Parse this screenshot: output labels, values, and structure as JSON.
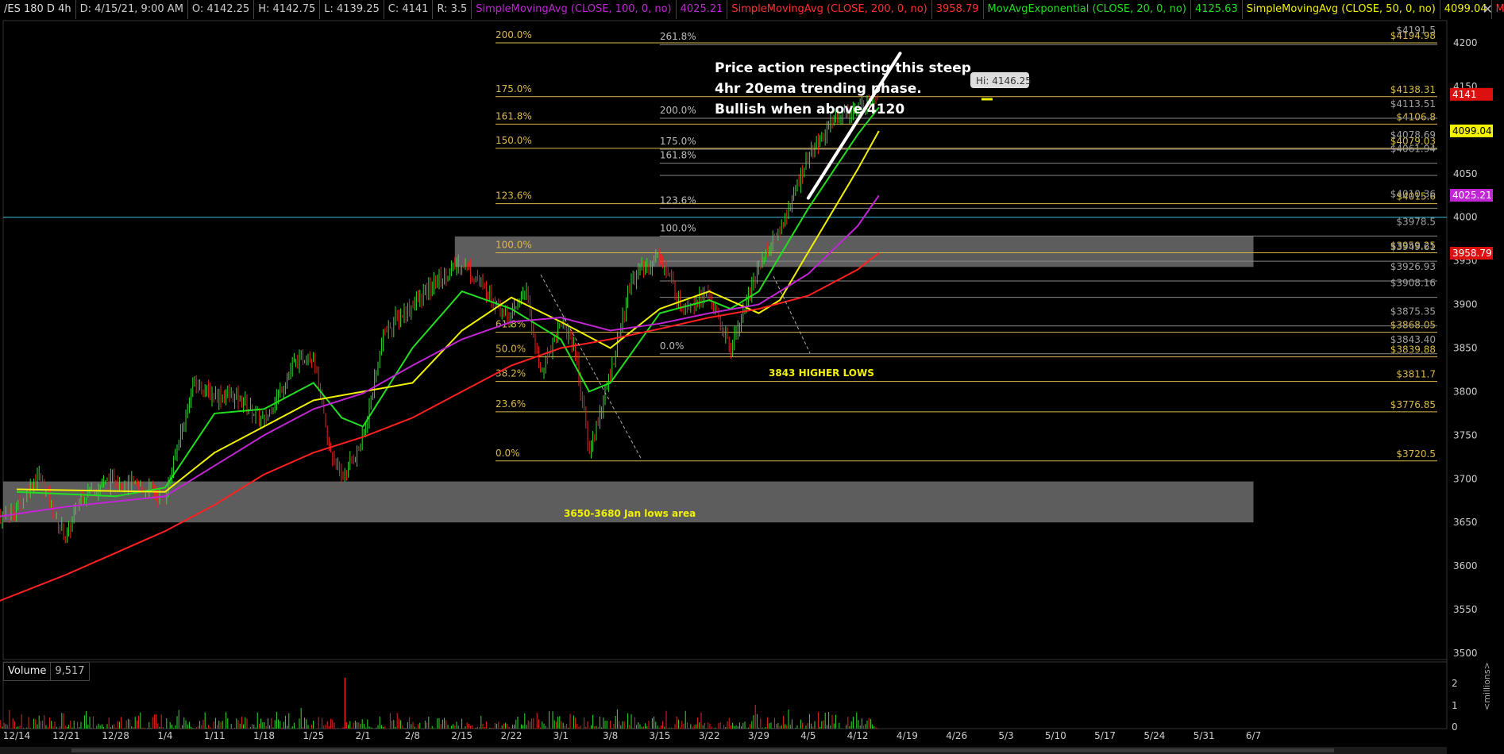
{
  "header": {
    "segments": [
      {
        "text": "/ES 180 D 4h",
        "color": "#dddddd"
      },
      {
        "text": "D: 4/15/21, 9:00 AM",
        "color": "#cccccc"
      },
      {
        "text": "O: 4142.25",
        "color": "#cccccc"
      },
      {
        "text": "H: 4142.75",
        "color": "#cccccc"
      },
      {
        "text": "L: 4139.25",
        "color": "#cccccc"
      },
      {
        "text": "C: 4141",
        "color": "#cccccc"
      },
      {
        "text": "R: 3.5",
        "color": "#cccccc"
      },
      {
        "text": "SimpleMovingAvg (CLOSE, 100, 0, no)",
        "color": "#c026d3"
      },
      {
        "text": "4025.21",
        "color": "#c026d3"
      },
      {
        "text": "SimpleMovingAvg (CLOSE, 200, 0, no)",
        "color": "#ff3030"
      },
      {
        "text": "3958.79",
        "color": "#ff3030"
      },
      {
        "text": "MovAvgExponential (CLOSE, 20, 0, no)",
        "color": "#22dd22"
      },
      {
        "text": "4125.63",
        "color": "#22dd22"
      },
      {
        "text": "SimpleMovingAvg (CLOSE, 50, 0, no)",
        "color": "#f2f200"
      },
      {
        "text": "4099.04",
        "color": "#f2f200"
      },
      {
        "text": "MovAvgExponential (CLOSE,...",
        "color": "#ff3030"
      }
    ],
    "close_icon": "close-icon"
  },
  "volume_panel": {
    "label": "Volume",
    "value": "9,517"
  },
  "colors": {
    "background": "#000000",
    "candle_up": "#33dd33",
    "candle_down": "#ee2222",
    "ema20": "#22dd22",
    "sma50": "#f2f200",
    "sma100": "#c026d3",
    "sma200": "#ff2020",
    "fib_primary": "#d9b84a",
    "fib_secondary": "#8a8a8a",
    "zone": "#777777",
    "reference_line": "#3cc4d8"
  },
  "chart_data": {
    "type": "candlestick",
    "symbol": "/ES",
    "aggregation": "180 D 4h",
    "y_axis": {
      "range": [
        3500,
        4225
      ],
      "ticks": [
        3500,
        3550,
        3600,
        3650,
        3700,
        3750,
        3800,
        3850,
        3900,
        3950,
        4000,
        4050,
        4100,
        4150,
        4200
      ]
    },
    "x_axis": {
      "ticks": [
        "12/14",
        "12/21",
        "12/28",
        "1/4",
        "1/11",
        "1/18",
        "1/25",
        "2/1",
        "2/8",
        "2/15",
        "2/22",
        "3/1",
        "3/8",
        "3/15",
        "3/22",
        "3/29",
        "4/5",
        "4/12",
        "4/19",
        "4/26",
        "5/3",
        "5/10",
        "5/17",
        "5/24",
        "5/31",
        "6/7"
      ]
    },
    "price_path": [
      {
        "date": "12/10",
        "price": 3650
      },
      {
        "date": "12/14",
        "price": 3665
      },
      {
        "date": "12/17",
        "price": 3705
      },
      {
        "date": "12/21",
        "price": 3630
      },
      {
        "date": "12/23",
        "price": 3680
      },
      {
        "date": "12/28",
        "price": 3700
      },
      {
        "date": "1/4",
        "price": 3680
      },
      {
        "date": "1/8",
        "price": 3810
      },
      {
        "date": "1/11",
        "price": 3795
      },
      {
        "date": "1/14",
        "price": 3795
      },
      {
        "date": "1/18",
        "price": 3765
      },
      {
        "date": "1/22",
        "price": 3830
      },
      {
        "date": "1/25",
        "price": 3845
      },
      {
        "date": "1/27",
        "price": 3740
      },
      {
        "date": "1/29",
        "price": 3700
      },
      {
        "date": "2/1",
        "price": 3745
      },
      {
        "date": "2/4",
        "price": 3870
      },
      {
        "date": "2/8",
        "price": 3900
      },
      {
        "date": "2/12",
        "price": 3930
      },
      {
        "date": "2/15",
        "price": 3950
      },
      {
        "date": "2/18",
        "price": 3920
      },
      {
        "date": "2/22",
        "price": 3885
      },
      {
        "date": "2/24",
        "price": 3920
      },
      {
        "date": "2/26",
        "price": 3820
      },
      {
        "date": "3/1",
        "price": 3880
      },
      {
        "date": "3/3",
        "price": 3850
      },
      {
        "date": "3/5",
        "price": 3730
      },
      {
        "date": "3/8",
        "price": 3820
      },
      {
        "date": "3/11",
        "price": 3930
      },
      {
        "date": "3/15",
        "price": 3955
      },
      {
        "date": "3/18",
        "price": 3900
      },
      {
        "date": "3/22",
        "price": 3910
      },
      {
        "date": "3/25",
        "price": 3848
      },
      {
        "date": "3/29",
        "price": 3945
      },
      {
        "date": "4/1",
        "price": 3985
      },
      {
        "date": "4/5",
        "price": 4070
      },
      {
        "date": "4/9",
        "price": 4115
      },
      {
        "date": "4/12",
        "price": 4125
      },
      {
        "date": "4/15",
        "price": 4141
      }
    ],
    "moving_averages": [
      {
        "name": "MovAvgExponential (CLOSE, 20, 0, no)",
        "last": 4125.63,
        "points": [
          {
            "date": "12/14",
            "price": 3685
          },
          {
            "date": "12/28",
            "price": 3680
          },
          {
            "date": "1/4",
            "price": 3690
          },
          {
            "date": "1/11",
            "price": 3775
          },
          {
            "date": "1/18",
            "price": 3780
          },
          {
            "date": "1/25",
            "price": 3810
          },
          {
            "date": "1/29",
            "price": 3770
          },
          {
            "date": "2/1",
            "price": 3760
          },
          {
            "date": "2/8",
            "price": 3850
          },
          {
            "date": "2/15",
            "price": 3915
          },
          {
            "date": "2/22",
            "price": 3895
          },
          {
            "date": "3/1",
            "price": 3860
          },
          {
            "date": "3/5",
            "price": 3800
          },
          {
            "date": "3/8",
            "price": 3810
          },
          {
            "date": "3/15",
            "price": 3890
          },
          {
            "date": "3/22",
            "price": 3905
          },
          {
            "date": "3/25",
            "price": 3895
          },
          {
            "date": "3/29",
            "price": 3915
          },
          {
            "date": "4/5",
            "price": 4010
          },
          {
            "date": "4/12",
            "price": 4095
          },
          {
            "date": "4/15",
            "price": 4126
          }
        ]
      },
      {
        "name": "SimpleMovingAvg (CLOSE, 50, 0, no)",
        "last": 4099.04,
        "points": [
          {
            "date": "12/14",
            "price": 3688
          },
          {
            "date": "1/4",
            "price": 3685
          },
          {
            "date": "1/11",
            "price": 3730
          },
          {
            "date": "1/18",
            "price": 3760
          },
          {
            "date": "1/25",
            "price": 3790
          },
          {
            "date": "2/1",
            "price": 3800
          },
          {
            "date": "2/8",
            "price": 3810
          },
          {
            "date": "2/15",
            "price": 3870
          },
          {
            "date": "2/22",
            "price": 3908
          },
          {
            "date": "3/1",
            "price": 3880
          },
          {
            "date": "3/8",
            "price": 3850
          },
          {
            "date": "3/15",
            "price": 3895
          },
          {
            "date": "3/22",
            "price": 3915
          },
          {
            "date": "3/29",
            "price": 3890
          },
          {
            "date": "4/1",
            "price": 3905
          },
          {
            "date": "4/5",
            "price": 3960
          },
          {
            "date": "4/12",
            "price": 4055
          },
          {
            "date": "4/15",
            "price": 4099
          }
        ]
      },
      {
        "name": "SimpleMovingAvg (CLOSE, 100, 0, no)",
        "last": 4025.21,
        "points": [
          {
            "date": "12/10",
            "price": 3655
          },
          {
            "date": "12/21",
            "price": 3668
          },
          {
            "date": "1/4",
            "price": 3680
          },
          {
            "date": "1/11",
            "price": 3715
          },
          {
            "date": "1/18",
            "price": 3750
          },
          {
            "date": "1/25",
            "price": 3780
          },
          {
            "date": "2/1",
            "price": 3798
          },
          {
            "date": "2/8",
            "price": 3830
          },
          {
            "date": "2/15",
            "price": 3860
          },
          {
            "date": "2/22",
            "price": 3880
          },
          {
            "date": "3/1",
            "price": 3885
          },
          {
            "date": "3/8",
            "price": 3870
          },
          {
            "date": "3/15",
            "price": 3878
          },
          {
            "date": "3/22",
            "price": 3890
          },
          {
            "date": "3/29",
            "price": 3900
          },
          {
            "date": "4/5",
            "price": 3935
          },
          {
            "date": "4/12",
            "price": 3990
          },
          {
            "date": "4/15",
            "price": 4025
          }
        ]
      },
      {
        "name": "SimpleMovingAvg (CLOSE, 200, 0, no)",
        "last": 3958.79,
        "points": [
          {
            "date": "12/10",
            "price": 3555
          },
          {
            "date": "12/21",
            "price": 3590
          },
          {
            "date": "1/4",
            "price": 3640
          },
          {
            "date": "1/11",
            "price": 3670
          },
          {
            "date": "1/18",
            "price": 3705
          },
          {
            "date": "1/25",
            "price": 3730
          },
          {
            "date": "2/1",
            "price": 3748
          },
          {
            "date": "2/8",
            "price": 3770
          },
          {
            "date": "2/15",
            "price": 3800
          },
          {
            "date": "2/22",
            "price": 3830
          },
          {
            "date": "3/1",
            "price": 3850
          },
          {
            "date": "3/8",
            "price": 3860
          },
          {
            "date": "3/15",
            "price": 3872
          },
          {
            "date": "3/22",
            "price": 3885
          },
          {
            "date": "3/29",
            "price": 3895
          },
          {
            "date": "4/5",
            "price": 3910
          },
          {
            "date": "4/12",
            "price": 3940
          },
          {
            "date": "4/15",
            "price": 3959
          }
        ]
      }
    ],
    "fib_primary": {
      "start_date": "2/22",
      "levels": [
        {
          "label": "200.0%",
          "price": 4200,
          "value_label": "$4194.98"
        },
        {
          "label": "175.0%",
          "price": 4138.31,
          "value_label": "$4138.31"
        },
        {
          "label": "161.8%",
          "price": 4106.8,
          "value_label": "$4106.8"
        },
        {
          "label": "150.0%",
          "price": 4079.03,
          "value_label": "$4079.03"
        },
        {
          "label": "123.6%",
          "price": 4015.6,
          "value_label": "$4015.6"
        },
        {
          "label": "100.0%",
          "price": 3959.25,
          "value_label": "$3959.25"
        },
        {
          "label": "61.8%",
          "price": 3868.05,
          "value_label": "$3868.05"
        },
        {
          "label": "50.0%",
          "price": 3839.88,
          "value_label": "$3839.88"
        },
        {
          "label": "38.2%",
          "price": 3811.7,
          "value_label": "$3811.7"
        },
        {
          "label": "23.6%",
          "price": 3776.85,
          "value_label": "$3776.85"
        },
        {
          "label": "0.0%",
          "price": 3720.5,
          "value_label": "$3720.5"
        }
      ]
    },
    "fib_secondary": {
      "start_date": "3/15",
      "levels": [
        {
          "label": "261.8%",
          "price": 4198,
          "value_label": "$4191.5"
        },
        {
          "label": "200.0%",
          "price": 4113.51,
          "value_label": "$4113.51"
        },
        {
          "label": "175.0%",
          "price": 4078,
          "value_label": "$4078.69"
        },
        {
          "label": "161.8%",
          "price": 4061.94,
          "value_label": "$4061.94"
        },
        {
          "label": "",
          "price": 4048,
          "value_label": ""
        },
        {
          "label": "123.6%",
          "price": 4010.36,
          "value_label": "$4010.36"
        },
        {
          "label": "100.0%",
          "price": 3978.5,
          "value_label": "$3978.5"
        },
        {
          "label": "",
          "price": 3949.61,
          "value_label": "$3949.61"
        },
        {
          "label": "",
          "price": 3926.93,
          "value_label": "$3926.93"
        },
        {
          "label": "",
          "price": 3908.16,
          "value_label": "$3908.16"
        },
        {
          "label": "",
          "price": 3875.35,
          "value_label": "$3875.35"
        },
        {
          "label": "0.0%",
          "price": 3843.4,
          "value_label": "$3843.40"
        }
      ]
    },
    "zones": [
      {
        "date_from": "2/14",
        "date_to": "6/7",
        "price_from": 3943,
        "price_to": 3978
      },
      {
        "date_from": "12/9",
        "date_to": "6/7",
        "price_from": 3650,
        "price_to": 3697
      }
    ],
    "horizontal_line": {
      "price": 4000
    },
    "trendline": {
      "from": {
        "date": "4/5",
        "price": 4022
      },
      "to": {
        "date": "4/18",
        "price": 4188
      }
    },
    "annotations": {
      "main_lines": [
        "Price action respecting this steep",
        "4hr 20ema trending phase.",
        "Bullish when above 4120"
      ],
      "higher_lows": "3843 HIGHER LOWS",
      "jan_lows": "3650-3680 Jan lows area",
      "hi_bubble": "Hi: 4146.25"
    },
    "price_tags": [
      {
        "text": "4141",
        "price": 4141,
        "bg": "#dd1010",
        "fg": "#ffffff"
      },
      {
        "text": "4099.04",
        "price": 4099.04,
        "bg": "#f2f200",
        "fg": "#000000"
      },
      {
        "text": "4025.21",
        "price": 4025.21,
        "bg": "#c026d3",
        "fg": "#ffffff"
      },
      {
        "text": "3958.79",
        "price": 3958.79,
        "bg": "#dd1010",
        "fg": "#ffffff"
      }
    ],
    "volume": {
      "y_ticks": [
        "2",
        "1",
        "0"
      ],
      "unit_label": "<millions>",
      "spike_date": "1/29"
    }
  }
}
